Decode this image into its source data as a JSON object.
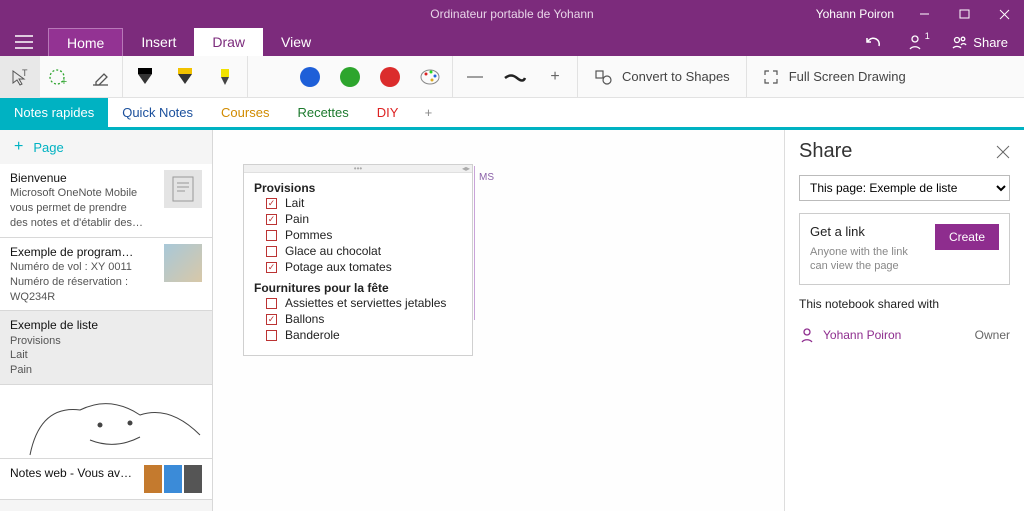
{
  "titlebar": {
    "title": "Ordinateur portable de Yohann",
    "user": "Yohann Poiron"
  },
  "tabs": {
    "home": "Home",
    "insert": "Insert",
    "draw": "Draw",
    "view": "View",
    "share": "Share"
  },
  "ribbon": {
    "colors": {
      "black": "#000000",
      "blue": "#1e5fd8",
      "green": "#2da52d",
      "red": "#db2c2c"
    },
    "convert": "Convert to Shapes",
    "fullscreen": "Full Screen Drawing"
  },
  "sections": [
    {
      "label": "Notes rapides",
      "color": "#00b2c2",
      "active": true
    },
    {
      "label": "Quick Notes",
      "color": "#1a4f9c"
    },
    {
      "label": "Courses",
      "color": "#d18b00"
    },
    {
      "label": "Recettes",
      "color": "#1d7a2e"
    },
    {
      "label": "DIY",
      "color": "#d22"
    }
  ],
  "page_list": {
    "add": "Page",
    "items": [
      {
        "title": "Bienvenue",
        "lines": [
          "Microsoft OneNote Mobile",
          "vous permet de prendre",
          "des notes et d'établir des…"
        ],
        "thumb": "doc"
      },
      {
        "title": "Exemple de program…",
        "lines": [
          "Numéro de vol : XY 0011",
          "Numéro de réservation :",
          "WQ234R"
        ],
        "thumb": "map"
      },
      {
        "title": "Exemple de liste",
        "lines": [
          "Provisions",
          "Lait",
          "Pain"
        ],
        "selected": true
      },
      {
        "title": "",
        "sketch": true
      },
      {
        "title": "Notes web - Vous av…",
        "web": true
      }
    ]
  },
  "note": {
    "author": "MS",
    "groups": [
      {
        "heading": "Provisions",
        "items": [
          {
            "label": "Lait",
            "checked": true
          },
          {
            "label": "Pain",
            "checked": true
          },
          {
            "label": "Pommes",
            "checked": false
          },
          {
            "label": "Glace au chocolat",
            "checked": false
          },
          {
            "label": "Potage aux tomates",
            "checked": true
          }
        ]
      },
      {
        "heading": "Fournitures pour la fête",
        "items": [
          {
            "label": "Assiettes et serviettes jetables",
            "checked": false
          },
          {
            "label": "Ballons",
            "checked": true
          },
          {
            "label": "Banderole",
            "checked": false
          }
        ]
      }
    ]
  },
  "share": {
    "title": "Share",
    "scope": "This page: Exemple de liste",
    "link_heading": "Get a link",
    "link_desc": "Anyone with the link can view the page",
    "create": "Create",
    "shared_with": "This notebook shared with",
    "people": [
      {
        "name": "Yohann Poiron",
        "role": "Owner"
      }
    ]
  }
}
